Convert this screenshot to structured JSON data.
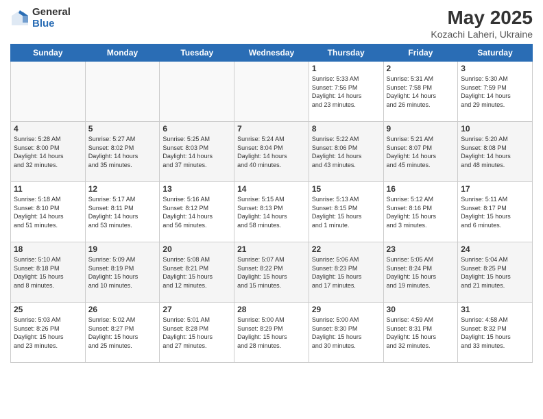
{
  "logo": {
    "general": "General",
    "blue": "Blue"
  },
  "title": "May 2025",
  "subtitle": "Kozachi Laheri, Ukraine",
  "headers": [
    "Sunday",
    "Monday",
    "Tuesday",
    "Wednesday",
    "Thursday",
    "Friday",
    "Saturday"
  ],
  "weeks": [
    [
      {
        "date": "",
        "content": ""
      },
      {
        "date": "",
        "content": ""
      },
      {
        "date": "",
        "content": ""
      },
      {
        "date": "",
        "content": ""
      },
      {
        "date": "1",
        "content": "Sunrise: 5:33 AM\nSunset: 7:56 PM\nDaylight: 14 hours\nand 23 minutes."
      },
      {
        "date": "2",
        "content": "Sunrise: 5:31 AM\nSunset: 7:58 PM\nDaylight: 14 hours\nand 26 minutes."
      },
      {
        "date": "3",
        "content": "Sunrise: 5:30 AM\nSunset: 7:59 PM\nDaylight: 14 hours\nand 29 minutes."
      }
    ],
    [
      {
        "date": "4",
        "content": "Sunrise: 5:28 AM\nSunset: 8:00 PM\nDaylight: 14 hours\nand 32 minutes."
      },
      {
        "date": "5",
        "content": "Sunrise: 5:27 AM\nSunset: 8:02 PM\nDaylight: 14 hours\nand 35 minutes."
      },
      {
        "date": "6",
        "content": "Sunrise: 5:25 AM\nSunset: 8:03 PM\nDaylight: 14 hours\nand 37 minutes."
      },
      {
        "date": "7",
        "content": "Sunrise: 5:24 AM\nSunset: 8:04 PM\nDaylight: 14 hours\nand 40 minutes."
      },
      {
        "date": "8",
        "content": "Sunrise: 5:22 AM\nSunset: 8:06 PM\nDaylight: 14 hours\nand 43 minutes."
      },
      {
        "date": "9",
        "content": "Sunrise: 5:21 AM\nSunset: 8:07 PM\nDaylight: 14 hours\nand 45 minutes."
      },
      {
        "date": "10",
        "content": "Sunrise: 5:20 AM\nSunset: 8:08 PM\nDaylight: 14 hours\nand 48 minutes."
      }
    ],
    [
      {
        "date": "11",
        "content": "Sunrise: 5:18 AM\nSunset: 8:10 PM\nDaylight: 14 hours\nand 51 minutes."
      },
      {
        "date": "12",
        "content": "Sunrise: 5:17 AM\nSunset: 8:11 PM\nDaylight: 14 hours\nand 53 minutes."
      },
      {
        "date": "13",
        "content": "Sunrise: 5:16 AM\nSunset: 8:12 PM\nDaylight: 14 hours\nand 56 minutes."
      },
      {
        "date": "14",
        "content": "Sunrise: 5:15 AM\nSunset: 8:13 PM\nDaylight: 14 hours\nand 58 minutes."
      },
      {
        "date": "15",
        "content": "Sunrise: 5:13 AM\nSunset: 8:15 PM\nDaylight: 15 hours\nand 1 minute."
      },
      {
        "date": "16",
        "content": "Sunrise: 5:12 AM\nSunset: 8:16 PM\nDaylight: 15 hours\nand 3 minutes."
      },
      {
        "date": "17",
        "content": "Sunrise: 5:11 AM\nSunset: 8:17 PM\nDaylight: 15 hours\nand 6 minutes."
      }
    ],
    [
      {
        "date": "18",
        "content": "Sunrise: 5:10 AM\nSunset: 8:18 PM\nDaylight: 15 hours\nand 8 minutes."
      },
      {
        "date": "19",
        "content": "Sunrise: 5:09 AM\nSunset: 8:19 PM\nDaylight: 15 hours\nand 10 minutes."
      },
      {
        "date": "20",
        "content": "Sunrise: 5:08 AM\nSunset: 8:21 PM\nDaylight: 15 hours\nand 12 minutes."
      },
      {
        "date": "21",
        "content": "Sunrise: 5:07 AM\nSunset: 8:22 PM\nDaylight: 15 hours\nand 15 minutes."
      },
      {
        "date": "22",
        "content": "Sunrise: 5:06 AM\nSunset: 8:23 PM\nDaylight: 15 hours\nand 17 minutes."
      },
      {
        "date": "23",
        "content": "Sunrise: 5:05 AM\nSunset: 8:24 PM\nDaylight: 15 hours\nand 19 minutes."
      },
      {
        "date": "24",
        "content": "Sunrise: 5:04 AM\nSunset: 8:25 PM\nDaylight: 15 hours\nand 21 minutes."
      }
    ],
    [
      {
        "date": "25",
        "content": "Sunrise: 5:03 AM\nSunset: 8:26 PM\nDaylight: 15 hours\nand 23 minutes."
      },
      {
        "date": "26",
        "content": "Sunrise: 5:02 AM\nSunset: 8:27 PM\nDaylight: 15 hours\nand 25 minutes."
      },
      {
        "date": "27",
        "content": "Sunrise: 5:01 AM\nSunset: 8:28 PM\nDaylight: 15 hours\nand 27 minutes."
      },
      {
        "date": "28",
        "content": "Sunrise: 5:00 AM\nSunset: 8:29 PM\nDaylight: 15 hours\nand 28 minutes."
      },
      {
        "date": "29",
        "content": "Sunrise: 5:00 AM\nSunset: 8:30 PM\nDaylight: 15 hours\nand 30 minutes."
      },
      {
        "date": "30",
        "content": "Sunrise: 4:59 AM\nSunset: 8:31 PM\nDaylight: 15 hours\nand 32 minutes."
      },
      {
        "date": "31",
        "content": "Sunrise: 4:58 AM\nSunset: 8:32 PM\nDaylight: 15 hours\nand 33 minutes."
      }
    ]
  ]
}
